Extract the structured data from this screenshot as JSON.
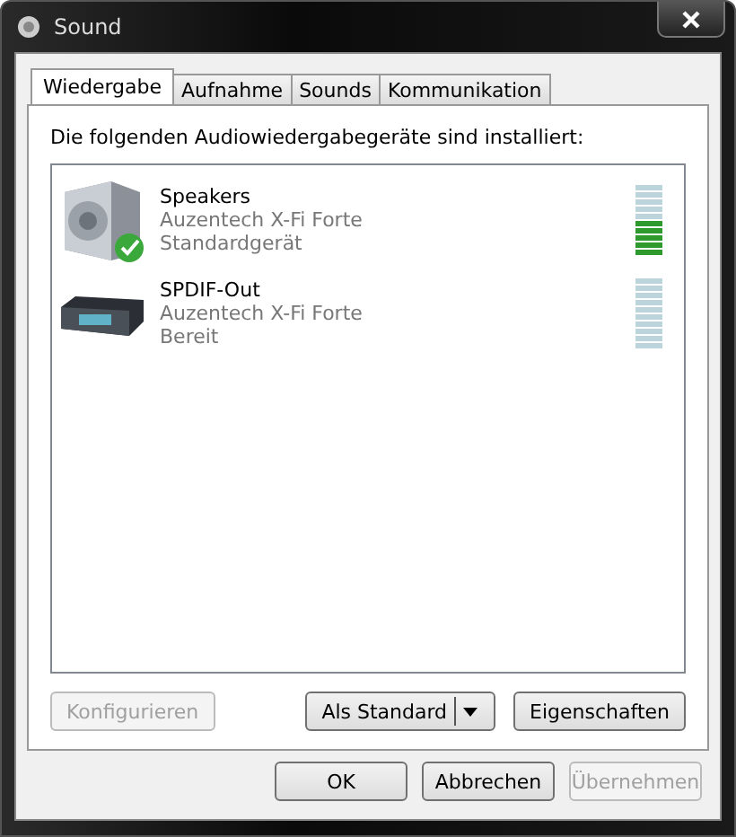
{
  "window": {
    "title": "Sound"
  },
  "tabs": [
    {
      "label": "Wiedergabe",
      "selected": true
    },
    {
      "label": "Aufnahme",
      "selected": false
    },
    {
      "label": "Sounds",
      "selected": false
    },
    {
      "label": "Kommunikation",
      "selected": false
    }
  ],
  "heading": "Die folgenden Audiowiedergabegeräte sind installiert:",
  "devices": [
    {
      "kind": "speaker",
      "name": "Speakers",
      "driver": "Auzentech X-Fi Forte",
      "status": "Standardgerät",
      "default": true,
      "level": 0.5
    },
    {
      "kind": "receiver",
      "name": "SPDIF-Out",
      "driver": "Auzentech X-Fi Forte",
      "status": "Bereit",
      "default": false
    }
  ],
  "panel_buttons": [
    {
      "label": "Konfigurieren",
      "disabled": true
    },
    {
      "label": "Als Standard",
      "disabled": false,
      "split": true
    },
    {
      "label": "Eigenschaften",
      "disabled": false
    }
  ],
  "dialog_buttons": [
    {
      "label": "OK",
      "disabled": false
    },
    {
      "label": "Abbrechen",
      "disabled": false
    },
    {
      "label": "Übernehmen",
      "disabled": true
    }
  ]
}
